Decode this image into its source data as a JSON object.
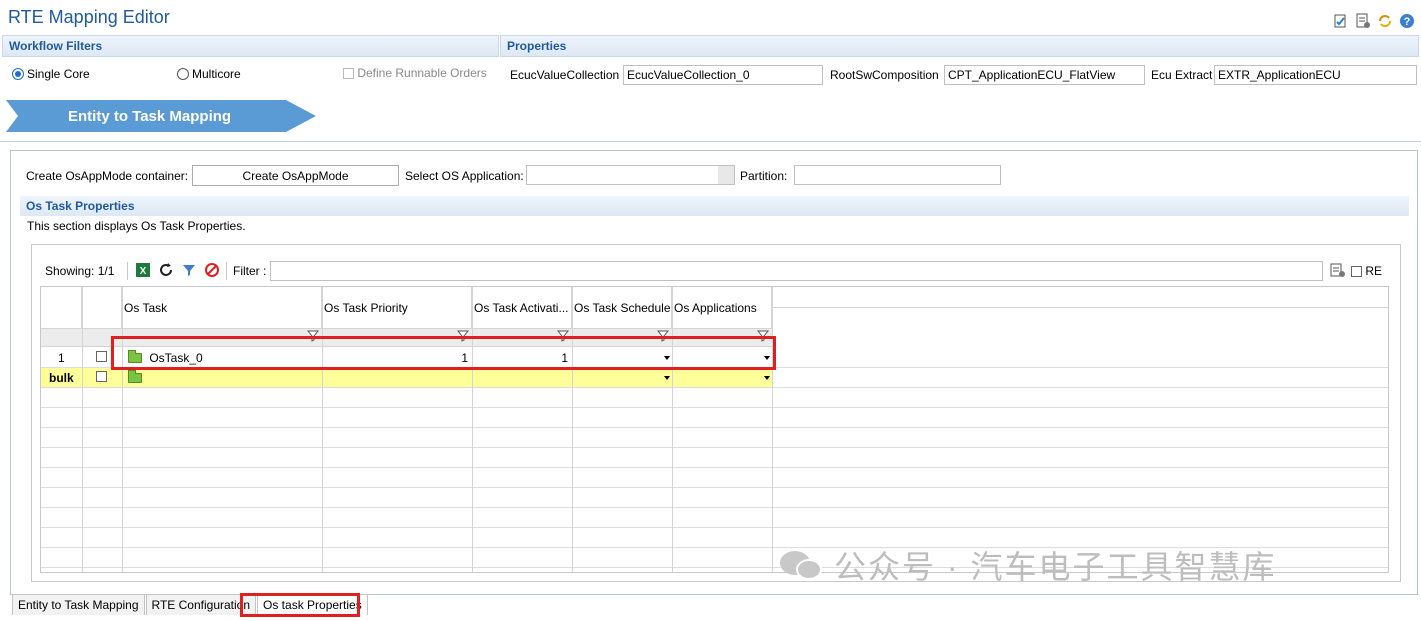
{
  "editor": {
    "title": "RTE Mapping Editor"
  },
  "workflow_filters": {
    "title": "Workflow Filters",
    "single_core": "Single Core",
    "multicore": "Multicore",
    "define_runnable_orders": "Define Runnable Orders"
  },
  "properties": {
    "title": "Properties",
    "ecuc_label": "EcucValueCollection",
    "ecuc_value": "EcucValueCollection_0",
    "rootsw_label": "RootSwComposition",
    "rootsw_value": "CPT_ApplicationECU_FlatView",
    "ecu_extract_label": "Ecu Extract",
    "ecu_extract_value": "EXTR_ApplicationECU"
  },
  "banner": {
    "label": "Entity to Task Mapping"
  },
  "os_app": {
    "create_label": "Create OsAppMode container:",
    "create_button": "Create OsAppMode",
    "select_label": "Select OS Application:",
    "select_value": "",
    "partition_label": "Partition:",
    "partition_value": ""
  },
  "os_task_section": {
    "title": "Os Task Properties",
    "description": "This section displays Os Task Properties."
  },
  "table_toolbar": {
    "showing": "Showing: 1/1",
    "filter_label": "Filter :",
    "filter_value": "",
    "re_label": "RE"
  },
  "table": {
    "columns": [
      "Os Task",
      "Os Task Priority",
      "Os Task Activati...",
      "Os Task Schedule",
      "Os Applications"
    ],
    "rows": [
      {
        "index": "1",
        "name": "OsTask_0",
        "priority": "1",
        "activation": "1",
        "schedule": "",
        "applications": ""
      }
    ],
    "bulk_label": "bulk"
  },
  "tabs": [
    "Entity to Task Mapping",
    "RTE Configuration",
    "Os task Properties"
  ],
  "watermark": {
    "text": "公众号 · 汽车电子工具智慧库"
  },
  "colors": {
    "accent": "#1f5a9e",
    "banner": "#5b9bd5",
    "highlight": "#e02020",
    "bulk_row": "#ffff99"
  }
}
